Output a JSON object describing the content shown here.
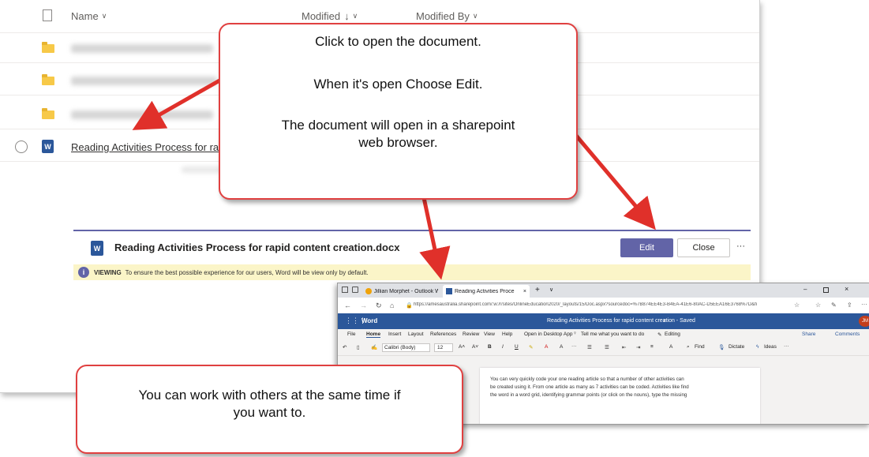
{
  "list": {
    "headers": {
      "name": "Name",
      "modified": "Modified",
      "modified_by": "Modified By"
    },
    "sort_indicator": "↓",
    "chevron": "∨",
    "file_name": "Reading Activities Process for rapid content creation.docx",
    "file_name_visible": "Reading Activities Process for ra",
    "file_icon_letter": "W"
  },
  "dialog": {
    "title": "Reading Activities Process for rapid content creation.docx",
    "edit_label": "Edit",
    "close_label": "Close",
    "more_label": "···",
    "viewing_label": "VIEWING",
    "viewing_text": "To ensure the best possible experience for our users, Word will be view only by default."
  },
  "browser": {
    "tab1": "Jillian Morphet - Outlook W",
    "tab2": "Reading Activities Proce",
    "tab_close": "×",
    "tab_new": "+",
    "url": "https://amesaustralia.sharepoint.com/:w:/r/sites/OnlineEducation2020/_layouts/15/Doc.aspx?sourcedoc=%7B874EE4E3-B4EA-41E6-80AC-D5EEA16E3768%7D&fi",
    "app_name": "Word",
    "doc_title": "Reading Activities Process for rapid content creation - Saved",
    "user_initials": "JM",
    "menu": [
      "File",
      "Home",
      "Insert",
      "Layout",
      "References",
      "Review",
      "View",
      "Help",
      "Open in Desktop App"
    ],
    "tell_me": "Tell me what you want to do",
    "editing": "Editing",
    "share": "Share",
    "comments": "Comments",
    "font_name": "Calibri (Body)",
    "font_size": "12",
    "find": "Find",
    "dictate": "Dictate",
    "ideas": "Ideas",
    "body_line1": "You can very quickly code your one reading article so that a number of other activities can",
    "body_line2": "be created using it. From one article as many as 7 activities can be coded. Activities like find",
    "body_line3": "the word in a word grid, identifying grammar points (or click on the nouns), type the missing"
  },
  "callouts": {
    "top_line1": "Click to open the document.",
    "top_line2": "When it's open Choose Edit.",
    "top_line3": "The document will open in a sharepoint",
    "top_line4": "web browser.",
    "bottom_line1": "You can work with others at the same time if",
    "bottom_line2": "you want to."
  },
  "colors": {
    "callout_border": "#e04040",
    "arrow": "#e0302a",
    "teams_purple": "#6264a7",
    "word_blue": "#2b579a",
    "folder_yellow": "#f7c948"
  }
}
